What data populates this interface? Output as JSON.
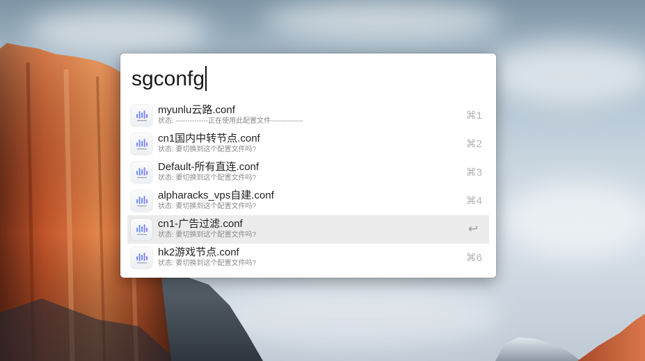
{
  "launcher": {
    "query": "sgconfg",
    "results": [
      {
        "title": "myunlu云路.conf",
        "subtitle": "状态: --------------正在使用此配置文件--------------",
        "shortcut": "⌘1",
        "selected": false,
        "icon": "surge-app-icon"
      },
      {
        "title": "cn1国内中转节点.conf",
        "subtitle": "状态: 要切换到这个配置文件吗?",
        "shortcut": "⌘2",
        "selected": false,
        "icon": "surge-app-icon"
      },
      {
        "title": "Default-所有直连.conf",
        "subtitle": "状态: 要切换到这个配置文件吗?",
        "shortcut": "⌘3",
        "selected": false,
        "icon": "surge-app-icon"
      },
      {
        "title": "alpharacks_vps自建.conf",
        "subtitle": "状态: 要切换到这个配置文件吗?",
        "shortcut": "⌘4",
        "selected": false,
        "icon": "surge-app-icon"
      },
      {
        "title": "cn1-广告过滤.conf",
        "subtitle": "状态: 要切换到这个配置文件吗?",
        "shortcut": "↩",
        "selected": true,
        "icon": "surge-app-icon"
      },
      {
        "title": "hk2游戏节点.conf",
        "subtitle": "状态: 要切换到这个配置文件吗?",
        "shortcut": "⌘6",
        "selected": false,
        "icon": "surge-app-icon"
      }
    ]
  },
  "colors": {
    "panel_bg": "#ffffff",
    "selected_row_bg": "#ececec",
    "shortcut_text": "#b3b3b3",
    "icon_gradient_start": "#3ec6ff",
    "icon_gradient_end": "#b04dff"
  }
}
